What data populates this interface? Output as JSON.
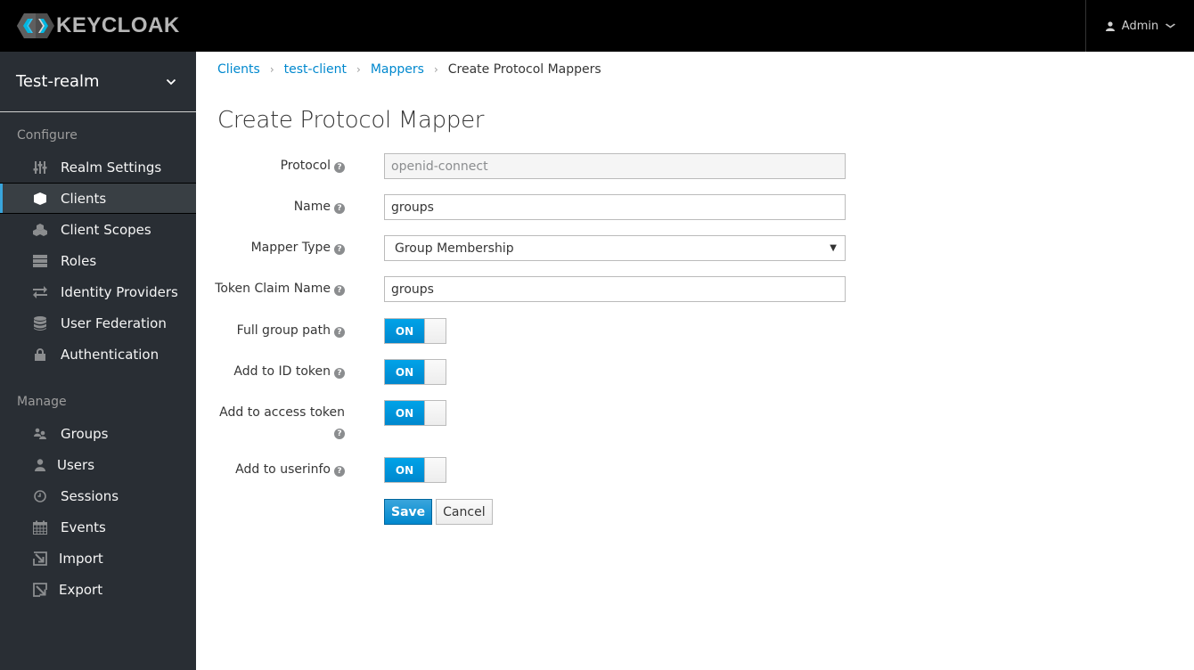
{
  "header": {
    "brand": "KEYCLOAK",
    "user_menu": {
      "label": "Admin",
      "icon": "user-icon",
      "caret": "chevron-down-icon"
    }
  },
  "sidebar": {
    "realm": {
      "name": "Test-realm",
      "icon": "chevron-down-icon"
    },
    "sections": [
      {
        "title": "Configure",
        "items": [
          {
            "label": "Realm Settings",
            "icon": "sliders-icon",
            "active": false
          },
          {
            "label": "Clients",
            "icon": "cube-icon",
            "active": true
          },
          {
            "label": "Client Scopes",
            "icon": "cubes-icon",
            "active": false
          },
          {
            "label": "Roles",
            "icon": "server-icon",
            "active": false
          },
          {
            "label": "Identity Providers",
            "icon": "exchange-icon",
            "active": false
          },
          {
            "label": "User Federation",
            "icon": "database-icon",
            "active": false
          },
          {
            "label": "Authentication",
            "icon": "lock-icon",
            "active": false
          }
        ]
      },
      {
        "title": "Manage",
        "items": [
          {
            "label": "Groups",
            "icon": "users-icon",
            "active": false
          },
          {
            "label": "Users",
            "icon": "user-icon",
            "active": false
          },
          {
            "label": "Sessions",
            "icon": "clock-icon",
            "active": false
          },
          {
            "label": "Events",
            "icon": "calendar-icon",
            "active": false
          },
          {
            "label": "Import",
            "icon": "import-icon",
            "active": false
          },
          {
            "label": "Export",
            "icon": "export-icon",
            "active": false
          }
        ]
      }
    ]
  },
  "breadcrumb": [
    {
      "label": "Clients",
      "link": true
    },
    {
      "label": "test-client",
      "link": true
    },
    {
      "label": "Mappers",
      "link": true
    },
    {
      "label": "Create Protocol Mappers",
      "link": false
    }
  ],
  "breadcrumb_separator": "›",
  "page": {
    "title": "Create Protocol Mapper"
  },
  "form": {
    "help_glyph": "?",
    "protocol": {
      "label": "Protocol",
      "value": "openid-connect",
      "readonly": true
    },
    "name": {
      "label": "Name",
      "value": "groups"
    },
    "mapper_type": {
      "label": "Mapper Type",
      "value": "Group Membership",
      "arrow": "▼"
    },
    "token_claim_name": {
      "label": "Token Claim Name",
      "value": "groups"
    },
    "full_group_path": {
      "label": "Full group path",
      "state": "ON",
      "checked": true
    },
    "add_to_id_token": {
      "label": "Add to ID token",
      "state": "ON",
      "checked": true
    },
    "add_to_access_token": {
      "label": "Add to access token",
      "state": "ON",
      "checked": true
    },
    "add_to_userinfo": {
      "label": "Add to userinfo",
      "state": "ON",
      "checked": true
    },
    "save_label": "Save",
    "cancel_label": "Cancel"
  },
  "colors": {
    "accent": "#0088ce",
    "topbar": "#000000",
    "sidebar": "#292e34",
    "active_indicator": "#39a5dc"
  }
}
